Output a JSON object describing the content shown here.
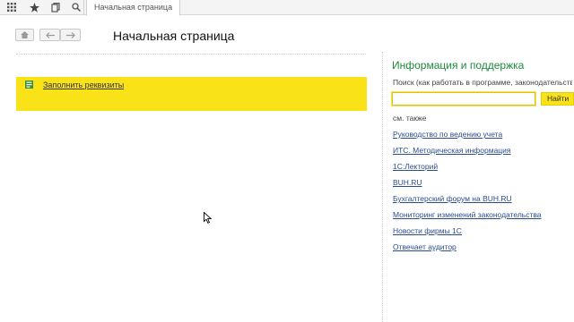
{
  "topbar": {
    "icons": [
      "apps-grid-icon",
      "star-icon",
      "history-icon",
      "search-icon"
    ],
    "tab_label": "Начальная страница"
  },
  "nav": {
    "home_icon": "home-icon",
    "back_icon": "arrow-left-icon",
    "forward_icon": "arrow-right-icon"
  },
  "page": {
    "title": "Начальная страница",
    "fill_link": "Заполнить реквизиты"
  },
  "info": {
    "title": "Информация и поддержка",
    "search_hint": "Поиск (как работать в программе, законодательство)",
    "search_value": "",
    "search_button": "Найти",
    "see_also": "см. также",
    "links": [
      "Руководство по ведению учета",
      "ИТС. Методическая информация",
      "1С:Лекторий",
      "BUH.RU",
      "Бухгалтерский форум на BUH.RU",
      "Мониторинг изменений законодательства",
      "Новости фирмы 1С",
      "Отвечает аудитор"
    ]
  },
  "colors": {
    "accent_yellow": "#f9e218",
    "heading_green": "#1c8a3c",
    "link_blue": "#2a4d8f"
  }
}
